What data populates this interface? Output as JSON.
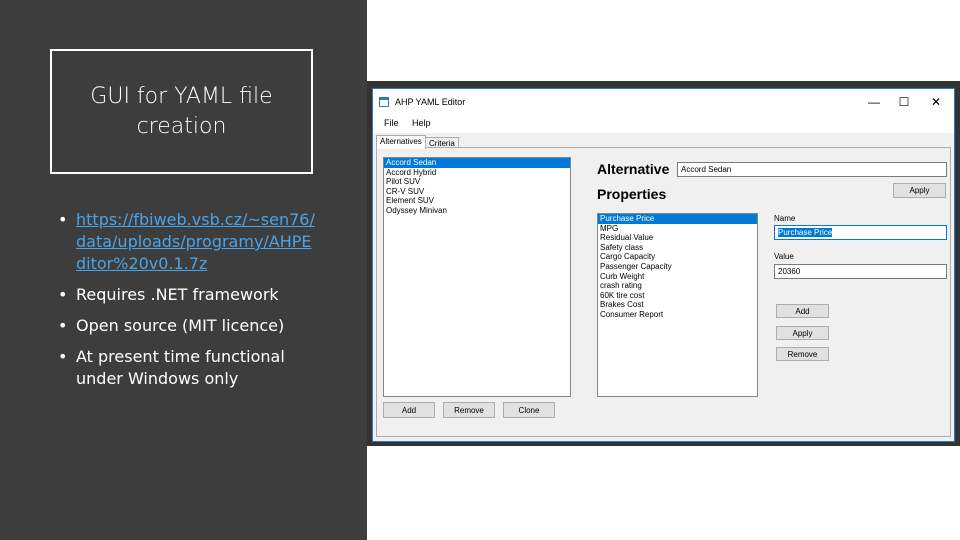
{
  "slide": {
    "title": "GUI for YAML file creation",
    "bullets": [
      {
        "text": "https://fbiweb.vsb.cz/~sen76/data/uploads/programy/AHPEditor%20v0.1.7z"
      },
      {
        "text": "Requires .NET framework"
      },
      {
        "text": "Open source (MIT licence)"
      },
      {
        "text": "At present time functional under Windows only"
      }
    ]
  },
  "window": {
    "title": "AHP YAML Editor",
    "controls": {
      "minimize": "—",
      "maximize": "☐",
      "close": "✕"
    },
    "menu": [
      "File",
      "Help"
    ],
    "tabs": [
      "Alternatives",
      "Criteria"
    ],
    "alternatives": [
      "Accord Sedan",
      "Accord Hybrid",
      "Pilot SUV",
      "CR-V SUV",
      "Element SUV",
      "Odyssey Minivan"
    ],
    "alternative_label": "Alternative",
    "alternative_value": "Accord Sedan",
    "apply_top": "Apply",
    "properties_label": "Properties",
    "properties": [
      "Purchase Price",
      "MPG",
      "Residual Value",
      "Safety class",
      "Cargo Capacity",
      "Passenger Capacity",
      "Curb Weight",
      "crash rating",
      "60K tire cost",
      "Brakes Cost",
      "Consumer Report"
    ],
    "name_label": "Name",
    "name_value": "Purchase Price",
    "value_label": "Value",
    "value_value": "20360",
    "prop_add": "Add",
    "prop_apply": "Apply",
    "prop_remove": "Remove",
    "alt_add": "Add",
    "alt_remove": "Remove",
    "alt_clone": "Clone"
  },
  "colors": {
    "panel": "#3d3d3d",
    "link": "#4aa3e8",
    "selection": "#0078d7"
  }
}
